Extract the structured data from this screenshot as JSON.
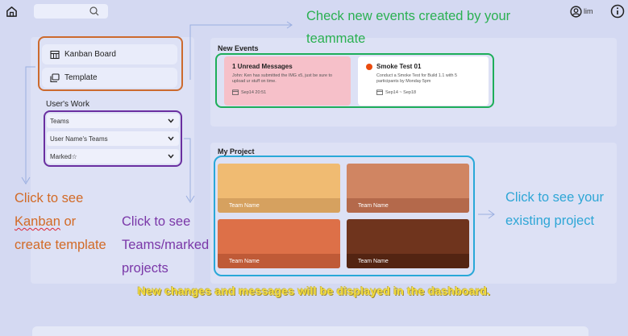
{
  "topbar": {
    "search_placeholder": "",
    "user_name": "lim",
    "icons": [
      "home-icon",
      "search-icon",
      "user-icon",
      "info-icon"
    ]
  },
  "sidebar": {
    "buttons": [
      {
        "label": "Kanban Board",
        "icon": "calendar-icon"
      },
      {
        "label": "Template",
        "icon": "template-icon"
      }
    ],
    "section_title": "User's Work",
    "dropdowns": [
      {
        "label": "Teams"
      },
      {
        "label": "User Name's Teams"
      },
      {
        "label": "Marked☆"
      }
    ]
  },
  "events": {
    "title": "New Events",
    "cards": [
      {
        "title": "1 Unread Messages",
        "body": "John: Ken has submitted the IMG x5, just be sure to upload ur stuff on time.",
        "date": "Sep14 20:51",
        "bg": "#f6c0c9"
      },
      {
        "title": "Smoke Test 01",
        "body": "Conduct a Smoke Test for Build 1.1 with 5 participants by Monday 5pm",
        "date": "Sep14 ~ Sep18",
        "bg": "#ffffff"
      }
    ]
  },
  "project": {
    "title": "My Project",
    "teams": [
      {
        "name": "Team Name",
        "color": "#f0bb72",
        "footer": "#d6a15f"
      },
      {
        "name": "Team Name",
        "color": "#d08562",
        "footer": "#b4694b"
      },
      {
        "name": "Team Name",
        "color": "#dd7048",
        "footer": "#bf5a37"
      },
      {
        "name": "Team Name",
        "color": "#6f341d",
        "footer": "#532412"
      }
    ]
  },
  "annotations": {
    "events": [
      "Check new events created by your",
      "teammate"
    ],
    "kanban": [
      "Click to see",
      "Kanban",
      " or",
      "create template"
    ],
    "teams": [
      "Click to see",
      "Teams/marked",
      "projects"
    ],
    "project": [
      "Click to see your",
      "existing project"
    ],
    "banner": "New changes and messages will be displayed in the dashboard."
  },
  "colors": {
    "background": "#d4d9f2",
    "orange": "#cc6a2e",
    "purple": "#6a2fa0",
    "green": "#1eae5a",
    "blue": "#29a8d8",
    "banner": "#f5dc3a"
  }
}
